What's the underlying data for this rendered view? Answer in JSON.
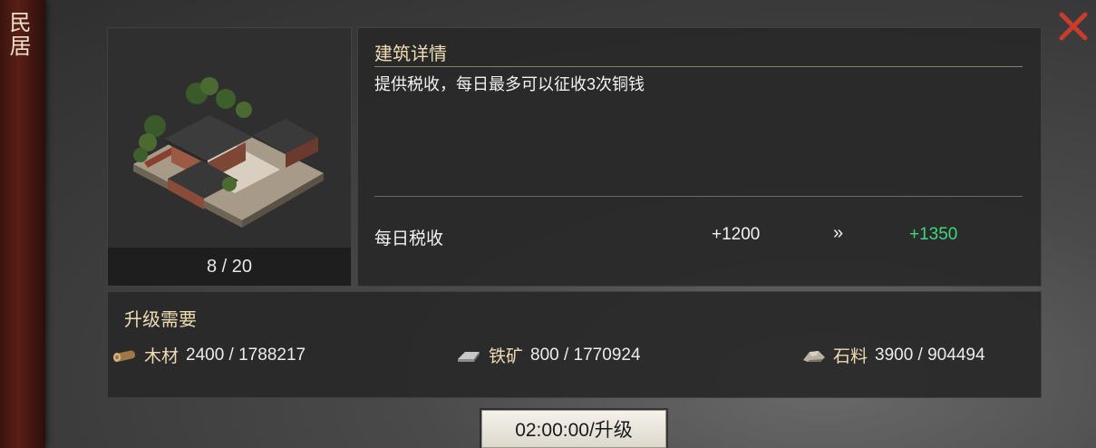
{
  "building": {
    "name": "民居",
    "level_text": "8 / 20"
  },
  "detail": {
    "title": "建筑详情",
    "description": "提供税收，每日最多可以征收3次铜钱",
    "stat_label": "每日税收",
    "stat_current": "+1200",
    "stat_arrow": "»",
    "stat_next": "+1350",
    "stat_next_color": "#3fd878"
  },
  "requirements": {
    "title": "升级需要",
    "items": [
      {
        "icon": "wood-log-icon",
        "name": "木材",
        "amount": "2400 / 1788217"
      },
      {
        "icon": "iron-ingot-icon",
        "name": "铁矿",
        "amount": "800 / 1770924"
      },
      {
        "icon": "stone-icon",
        "name": "石料",
        "amount": "3900 / 904494"
      }
    ]
  },
  "upgrade_button": {
    "label": "02:00:00/升级"
  },
  "colors": {
    "accent_gold": "#f0dcb4",
    "banner_red": "#5a1e16",
    "close_red": "#c93c2c"
  }
}
